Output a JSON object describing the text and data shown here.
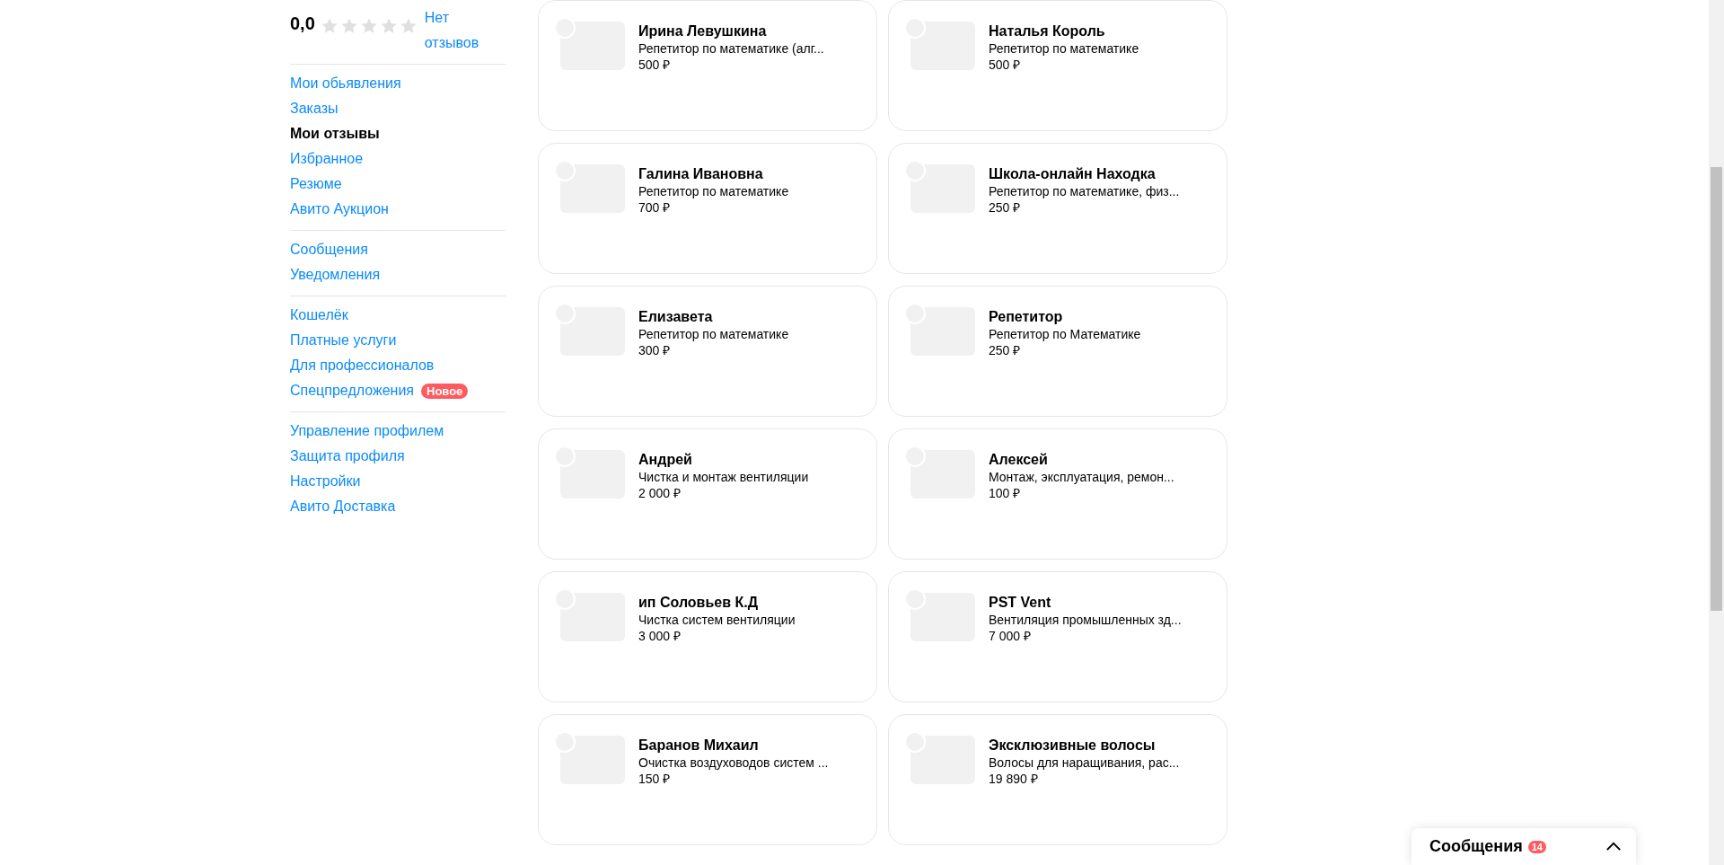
{
  "rating": {
    "value": "0,0",
    "stars": 0,
    "reviews_link": "Нет отзывов"
  },
  "sidebar": {
    "groups": [
      [
        {
          "label": "Мои обьявления",
          "selected": false
        },
        {
          "label": "Заказы",
          "selected": false
        },
        {
          "label": "Мои отзывы",
          "selected": true
        },
        {
          "label": "Избранное",
          "selected": false
        },
        {
          "label": "Резюме",
          "selected": false
        },
        {
          "label": "Авито Аукцион",
          "selected": false
        }
      ],
      [
        {
          "label": "Сообщения",
          "selected": false
        },
        {
          "label": "Уведомления",
          "selected": false
        }
      ],
      [
        {
          "label": "Кошелёк",
          "selected": false
        },
        {
          "label": "Платные услуги",
          "selected": false
        },
        {
          "label": "Для профессионалов",
          "selected": false
        },
        {
          "label": "Спецпредложения",
          "selected": false,
          "badge": "Новое"
        }
      ],
      [
        {
          "label": "Управление профилем",
          "selected": false
        },
        {
          "label": "Защита профиля",
          "selected": false
        },
        {
          "label": "Настройки",
          "selected": false
        },
        {
          "label": "Авито Доставка",
          "selected": false
        }
      ]
    ]
  },
  "cards": [
    {
      "title": "Ирина Левушкина",
      "subtitle": "Репетитор по математике (алг...",
      "price": "500 ₽"
    },
    {
      "title": "Наталья Король",
      "subtitle": "Репетитор по математике",
      "price": "500 ₽"
    },
    {
      "title": "Галина Ивановна",
      "subtitle": "Репетитор по математике",
      "price": "700 ₽"
    },
    {
      "title": "Школа-онлайн Находка",
      "subtitle": "Репетитор по математике, физ...",
      "price": "250 ₽"
    },
    {
      "title": "Елизавета",
      "subtitle": "Репетитор по математике",
      "price": "300 ₽"
    },
    {
      "title": "Репетитор",
      "subtitle": "Репетитор по Математике",
      "price": "250 ₽"
    },
    {
      "title": "Андрей",
      "subtitle": "Чистка и монтаж вентиляции",
      "price": "2 000 ₽"
    },
    {
      "title": "Алексей",
      "subtitle": "Монтаж, эксплуатация, ремон...",
      "price": "100 ₽"
    },
    {
      "title": "ип Соловьев К.Д",
      "subtitle": "Чистка систем вентиляции",
      "price": "3 000 ₽"
    },
    {
      "title": "PST Vent",
      "subtitle": "Вентиляция промышленных зд...",
      "price": "7 000 ₽"
    },
    {
      "title": "Баранов Михаил",
      "subtitle": "Очистка воздуховодов систем ...",
      "price": "150 ₽"
    },
    {
      "title": "Эксклюзивные волосы",
      "subtitle": "Волосы для наращивания, рас...",
      "price": "19 890 ₽"
    }
  ],
  "messages_widget": {
    "title": "Сообщения",
    "count": "14",
    "expanded": false
  }
}
